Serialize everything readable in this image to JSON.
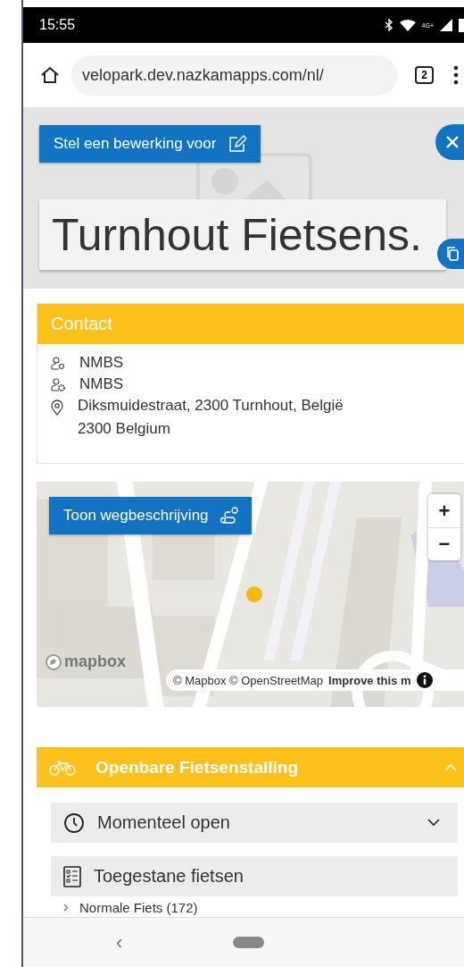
{
  "status_bar": {
    "time": "15:55",
    "network": "4G+"
  },
  "browser": {
    "url": "velopark.dev.nazkamapps.com/nl/",
    "tab_count": "2"
  },
  "header": {
    "edit_button": "Stel een bewerking voor",
    "title": "Turnhout Fietsens."
  },
  "contact": {
    "title": "Contact",
    "rows": [
      {
        "kind": "owner",
        "lines": [
          "NMBS"
        ]
      },
      {
        "kind": "operator",
        "lines": [
          "NMBS"
        ]
      },
      {
        "kind": "address",
        "lines": [
          "Diksmuidestraat, 2300 Turnhout, België",
          "2300 Belgium"
        ]
      }
    ]
  },
  "map": {
    "directions_button": "Toon wegbeschrijving",
    "zoom_in": "+",
    "zoom_out": "−",
    "logo": "mapbox",
    "attribution": "© Mapbox © OpenStreetMap",
    "improve_link": "Improve this m"
  },
  "section": {
    "title": "Openbare Fietsenstalling",
    "expanded": true,
    "panels": [
      {
        "kind": "hours",
        "title": "Momenteel open",
        "expanded": false
      },
      {
        "kind": "bikes",
        "title": "Toegestane fietsen",
        "items": [
          {
            "label": "Normale Fiets (172)"
          }
        ]
      }
    ]
  },
  "nav_bar": {
    "back": "‹"
  }
}
